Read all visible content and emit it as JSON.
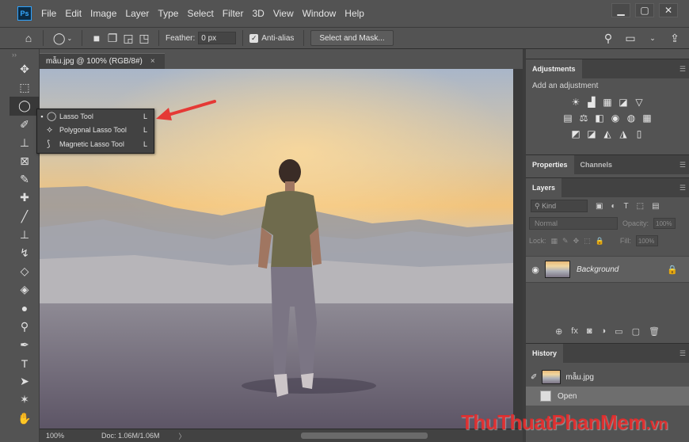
{
  "app": {
    "logo_text": "Ps",
    "menu": [
      "File",
      "Edit",
      "Image",
      "Layer",
      "Type",
      "Select",
      "Filter",
      "3D",
      "View",
      "Window",
      "Help"
    ],
    "window_controls": [
      "▁",
      "▢",
      "✕"
    ]
  },
  "options": {
    "feather_label": "Feather:",
    "feather_value": "0 px",
    "antialias_label": "Anti-alias",
    "select_mask_label": "Select and Mask..."
  },
  "toolbar": {
    "collapse": "››",
    "tools": [
      {
        "name": "move-tool",
        "glyph": "✥"
      },
      {
        "name": "marquee-tool",
        "glyph": "⬚"
      },
      {
        "name": "lasso-tool",
        "glyph": "◯",
        "active": true
      },
      {
        "name": "quick-selection-tool",
        "glyph": "✐"
      },
      {
        "name": "crop-tool",
        "glyph": "⊥"
      },
      {
        "name": "frame-tool",
        "glyph": "⊠"
      },
      {
        "name": "eyedropper-tool",
        "glyph": "✎"
      },
      {
        "name": "healing-brush-tool",
        "glyph": "✚"
      },
      {
        "name": "brush-tool",
        "glyph": "╱"
      },
      {
        "name": "clone-stamp-tool",
        "glyph": "⊥"
      },
      {
        "name": "history-brush-tool",
        "glyph": "↯"
      },
      {
        "name": "eraser-tool",
        "glyph": "◇"
      },
      {
        "name": "paint-bucket-tool",
        "glyph": "◈"
      },
      {
        "name": "blur-tool",
        "glyph": "●"
      },
      {
        "name": "dodge-tool",
        "glyph": "⚲"
      },
      {
        "name": "pen-tool",
        "glyph": "✒"
      },
      {
        "name": "type-tool",
        "glyph": "T"
      },
      {
        "name": "path-selection-tool",
        "glyph": "➤"
      },
      {
        "name": "shape-tool",
        "glyph": "✶"
      },
      {
        "name": "hand-tool",
        "glyph": "✋"
      }
    ]
  },
  "document": {
    "tab_title": "mẫu.jpg @ 100% (RGB/8#)",
    "tab_close": "×",
    "zoom": "100%",
    "doc_size": "Doc: 1.06M/1.06M",
    "status_arrow": "〉"
  },
  "flyout": {
    "items": [
      {
        "label": "Lasso Tool",
        "key": "L",
        "selected": true,
        "icon": "◯"
      },
      {
        "label": "Polygonal Lasso Tool",
        "key": "L",
        "selected": false,
        "icon": "⟡"
      },
      {
        "label": "Magnetic Lasso Tool",
        "key": "L",
        "selected": false,
        "icon": "⟆"
      }
    ]
  },
  "panels": {
    "adjustments": {
      "tab": "Adjustments",
      "subtitle": "Add an adjustment",
      "rows": [
        [
          "☀",
          "▟",
          "▦",
          "◪",
          "▽"
        ],
        [
          "▤",
          "⚖",
          "◧",
          "◉",
          "◍",
          "▦"
        ],
        [
          "◩",
          "◪",
          "◭",
          "◮",
          "▯"
        ]
      ]
    },
    "properties": {
      "tabs": [
        "Properties",
        "Channels"
      ]
    },
    "layers": {
      "tab": "Layers",
      "kind_placeholder": "⚲ Kind",
      "filter_icons": [
        "▣",
        "◐",
        "T",
        "⬚",
        "▤"
      ],
      "blend_mode": "Normal",
      "opacity_label": "Opacity:",
      "opacity_value": "100%",
      "lock_label": "Lock:",
      "lock_icons": [
        "▦",
        "✎",
        "✥",
        "⬚",
        "🔒"
      ],
      "fill_label": "Fill:",
      "fill_value": "100%",
      "layer_name": "Background",
      "eye_glyph": "◉",
      "lock_glyph": "🔒",
      "bottom_icons": [
        "⊕",
        "fx",
        "◙",
        "◑",
        "▭",
        "▢",
        "🗑"
      ]
    },
    "history": {
      "tab": "History",
      "snapshot_name": "mẫu.jpg",
      "brush_glyph": "✐",
      "steps": [
        "Open"
      ]
    }
  },
  "watermark": {
    "text": "ThuThuatPhanMem",
    "suffix": ".vn"
  },
  "colors": {
    "ui_bg": "#535353",
    "panel_dark": "#424242",
    "annotation_arrow": "#e53935",
    "ps_blue": "#36a9ff"
  }
}
